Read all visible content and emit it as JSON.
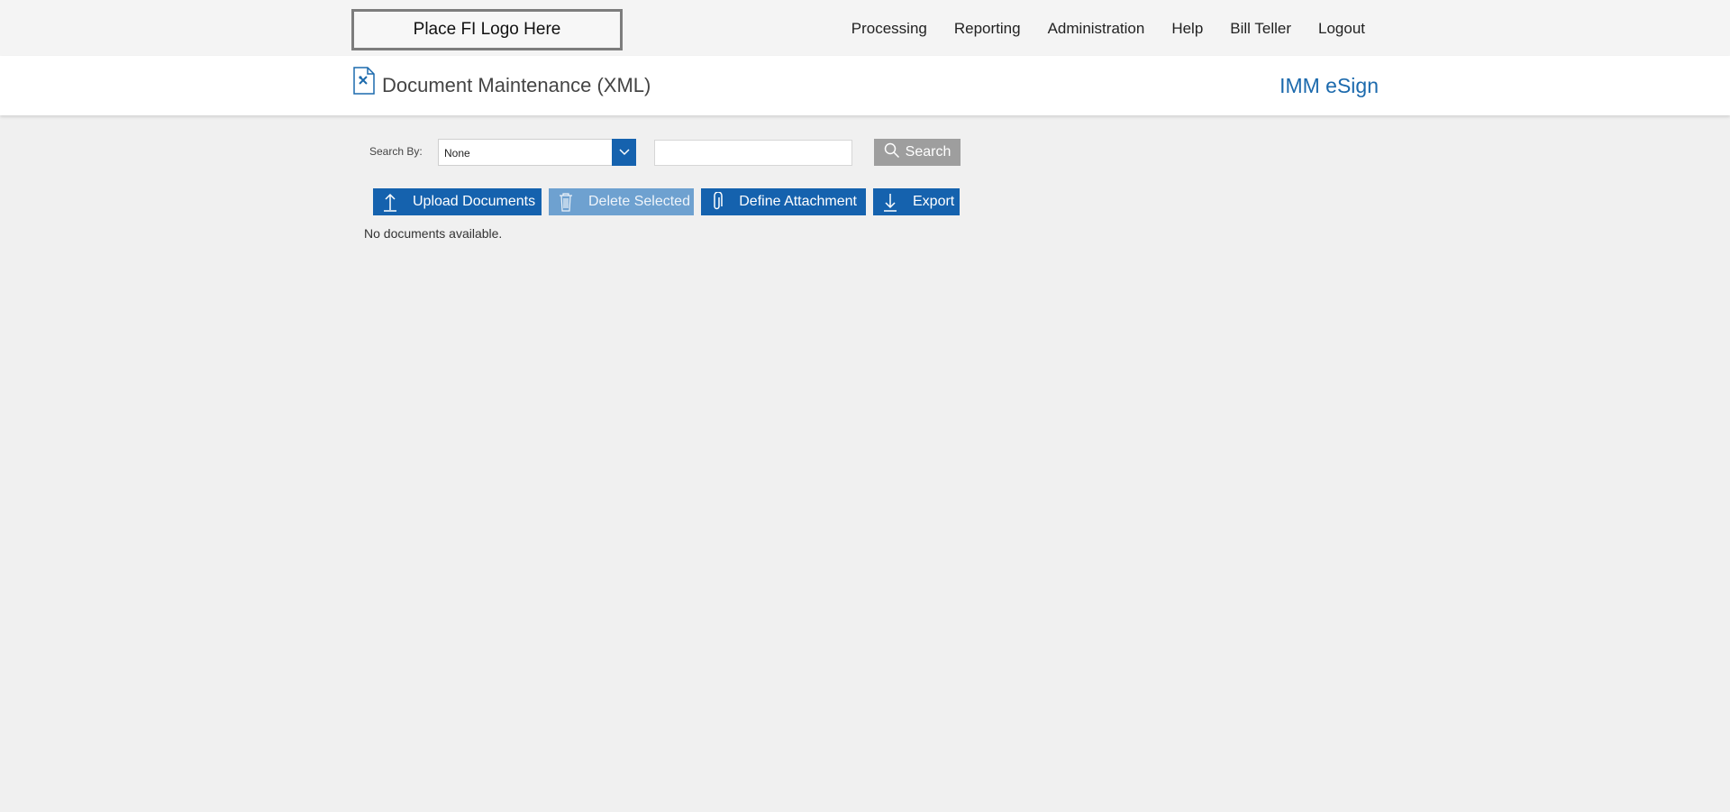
{
  "header": {
    "logo_text": "Place FI Logo Here",
    "nav": [
      "Processing",
      "Reporting",
      "Administration",
      "Help",
      "Bill Teller",
      "Logout"
    ]
  },
  "title_bar": {
    "page_title": "Document Maintenance (XML)",
    "app_name": "IMM eSign"
  },
  "search": {
    "label": "Search By:",
    "selected_option": "None",
    "input_value": "",
    "button_label": "Search"
  },
  "actions": {
    "upload": "Upload Documents",
    "delete": "Delete Selected",
    "define": "Define Attachment",
    "export": "Export"
  },
  "empty_message": "No documents available.",
  "colors": {
    "accent": "#1562ae",
    "app_name": "#1c6aad",
    "disabled_button": "#6ea1d0",
    "search_button": "#9e9e9e"
  },
  "icons": [
    "document-icon",
    "chevron-down-icon",
    "search-icon",
    "upload-icon",
    "trash-icon",
    "paperclip-icon",
    "download-icon"
  ]
}
